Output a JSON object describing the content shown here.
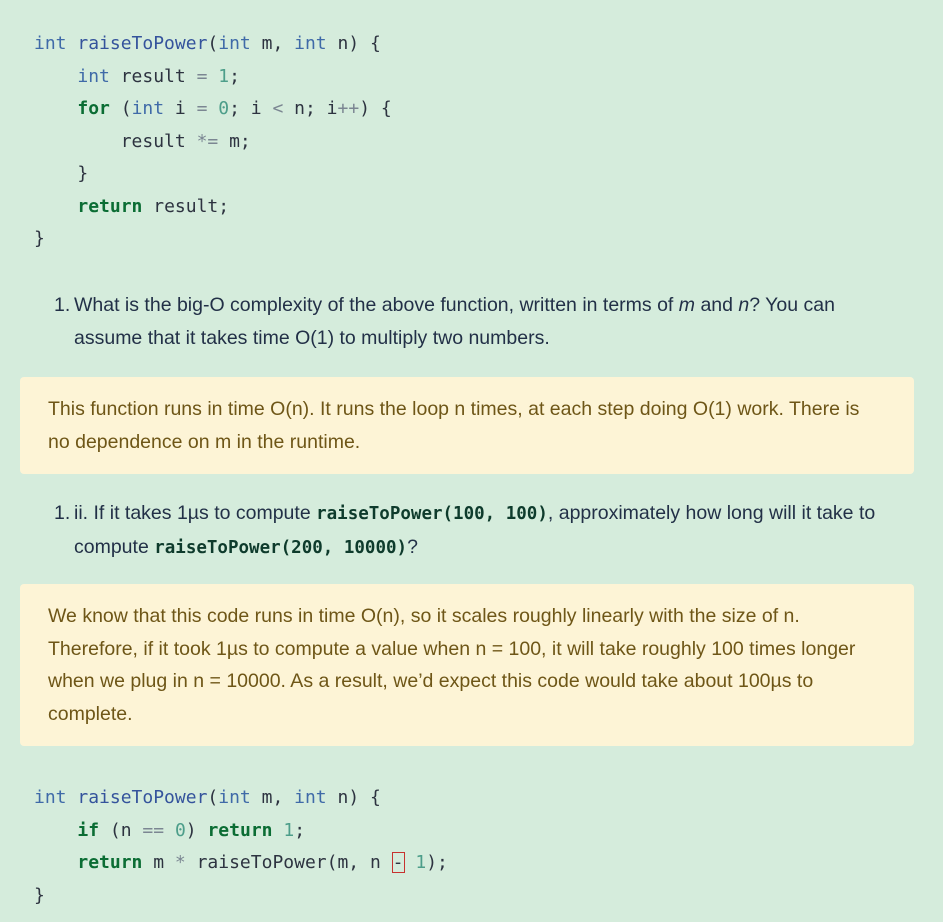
{
  "code_block_1": {
    "lines": [
      [
        [
          "type",
          "int"
        ],
        [
          "plain",
          " "
        ],
        [
          "fn",
          "raiseToPower"
        ],
        [
          "plain",
          "("
        ],
        [
          "type",
          "int"
        ],
        [
          "plain",
          " m, "
        ],
        [
          "type",
          "int"
        ],
        [
          "plain",
          " n) {"
        ]
      ],
      [
        [
          "plain",
          "    "
        ],
        [
          "type",
          "int"
        ],
        [
          "plain",
          " result "
        ],
        [
          "op",
          "="
        ],
        [
          "plain",
          " "
        ],
        [
          "num",
          "1"
        ],
        [
          "plain",
          ";"
        ]
      ],
      [
        [
          "plain",
          "    "
        ],
        [
          "kw",
          "for"
        ],
        [
          "plain",
          " ("
        ],
        [
          "type",
          "int"
        ],
        [
          "plain",
          " i "
        ],
        [
          "op",
          "="
        ],
        [
          "plain",
          " "
        ],
        [
          "num",
          "0"
        ],
        [
          "plain",
          "; i "
        ],
        [
          "op",
          "<"
        ],
        [
          "plain",
          " n; i"
        ],
        [
          "op",
          "++"
        ],
        [
          "plain",
          ") {"
        ]
      ],
      [
        [
          "plain",
          "        result "
        ],
        [
          "op",
          "*="
        ],
        [
          "plain",
          " m;"
        ]
      ],
      [
        [
          "plain",
          "    }"
        ]
      ],
      [
        [
          "plain",
          "    "
        ],
        [
          "kw",
          "return"
        ],
        [
          "plain",
          " result;"
        ]
      ],
      [
        [
          "plain",
          "}"
        ]
      ]
    ]
  },
  "question_1": {
    "number": "1.",
    "line1_parts": [
      {
        "t": "What is the big-O complexity of the above function, written in terms of ",
        "s": "plain"
      },
      {
        "t": "m",
        "s": "italic"
      },
      {
        "t": " and ",
        "s": "plain"
      },
      {
        "t": "n",
        "s": "italic"
      },
      {
        "t": "? You can",
        "s": "plain"
      }
    ],
    "line2": "assume that it takes time O(1) to multiply two numbers."
  },
  "answer_1": {
    "lines": [
      "This function runs in time O(n). It runs the loop n times, at each step doing O(1) work. There is",
      "no dependence on m in the runtime."
    ]
  },
  "question_2": {
    "number": "1.",
    "line1_parts": [
      {
        "t": "ii. If it takes 1µs to compute ",
        "s": "plain"
      },
      {
        "t": "raiseToPower(100, 100)",
        "s": "code"
      },
      {
        "t": ", approximately how long will it take to",
        "s": "plain"
      }
    ],
    "line2_parts": [
      {
        "t": "compute ",
        "s": "plain"
      },
      {
        "t": "raiseToPower(200, 10000)",
        "s": "code"
      },
      {
        "t": "?",
        "s": "plain"
      }
    ]
  },
  "answer_2": {
    "lines": [
      "We know that this code runs in time O(n), so it scales roughly linearly with the size of n.",
      "Therefore, if it took 1µs to compute a value when n = 100, it will take roughly 100 times longer",
      "when we plug in n = 10000. As a result, we’d expect this code would take about 100µs to",
      "complete."
    ]
  },
  "code_block_2": {
    "lines": [
      [
        [
          "type",
          "int"
        ],
        [
          "plain",
          " "
        ],
        [
          "fn",
          "raiseToPower"
        ],
        [
          "plain",
          "("
        ],
        [
          "type",
          "int"
        ],
        [
          "plain",
          " m, "
        ],
        [
          "type",
          "int"
        ],
        [
          "plain",
          " n) {"
        ]
      ],
      [
        [
          "plain",
          "    "
        ],
        [
          "kw",
          "if"
        ],
        [
          "plain",
          " (n "
        ],
        [
          "op",
          "=="
        ],
        [
          "plain",
          " "
        ],
        [
          "num",
          "0"
        ],
        [
          "plain",
          ") "
        ],
        [
          "kw",
          "return"
        ],
        [
          "plain",
          " "
        ],
        [
          "num",
          "1"
        ],
        [
          "plain",
          ";"
        ]
      ],
      [
        [
          "plain",
          "    "
        ],
        [
          "kw",
          "return"
        ],
        [
          "plain",
          " m "
        ],
        [
          "op",
          "*"
        ],
        [
          "plain",
          " raiseToPower(m, n "
        ],
        [
          "err",
          "-"
        ],
        [
          "plain",
          " "
        ],
        [
          "num",
          "1"
        ],
        [
          "plain",
          ");"
        ]
      ],
      [
        [
          "plain",
          "}"
        ]
      ]
    ]
  },
  "colors": {
    "page_background": "#d5ecdc",
    "answer_background": "#fdf4d6",
    "answer_text": "#6e5617",
    "keyword": "#0b6d34",
    "type": "#3f6aa8",
    "number": "#4d9e8a",
    "error_outline": "#c7322f"
  }
}
